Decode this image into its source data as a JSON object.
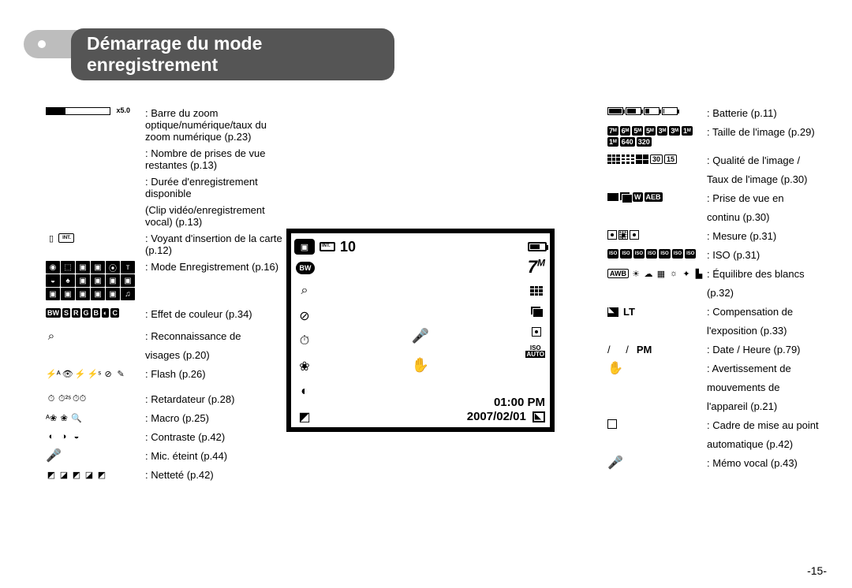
{
  "header": {
    "title": "Démarrage du mode enregistrement"
  },
  "page_number": "-15-",
  "left": {
    "zoom": {
      "scale_label": "x5.0",
      "text": "Barre du zoom optique/numérique/taux du zoom numérique (p.23)"
    },
    "shots": {
      "text": "Nombre de prises de vue restantes (p.13)"
    },
    "duration1": {
      "text": "Durée d'enregistrement disponible"
    },
    "duration2": {
      "text": "(Clip vidéo/enregistrement vocal) (p.13)"
    },
    "card": {
      "text": "Voyant d'insertion de la carte (p.12)"
    },
    "mode": {
      "text": "Mode Enregistrement (p.16)"
    },
    "color": {
      "text": "Effet de couleur (p.34)"
    },
    "face1": {
      "text": "Reconnaissance de"
    },
    "face2": {
      "text": "visages (p.20)"
    },
    "flash": {
      "text": "Flash (p.26)"
    },
    "timer": {
      "text": "Retardateur (p.28)"
    },
    "macro": {
      "text": "Macro (p.25)"
    },
    "contrast": {
      "text": "Contraste (p.42)"
    },
    "mic": {
      "text": "Mic. éteint (p.44)"
    },
    "sharp": {
      "text": "Netteté (p.42)"
    }
  },
  "lcd": {
    "shots_remaining": "10",
    "resolution": "7",
    "resolution_suffix": "M",
    "iso_label": "ISO",
    "iso_mode": "AUTO",
    "time": "01:00 PM",
    "date": "2007/02/01"
  },
  "right": {
    "battery": {
      "text": "Batterie (p.11)"
    },
    "size": {
      "text": "Taille de l'image (p.29)",
      "labels": [
        "7ᴹ",
        "6ᴹ",
        "5ᴹ",
        "5ᴹ",
        "3ᴹ",
        "3ᴹ",
        "1ᴹ",
        "1ᴹ",
        "640",
        "320"
      ]
    },
    "quality1": {
      "text": "Qualité de l'image /",
      "fr": [
        "30",
        "15"
      ]
    },
    "quality2": {
      "text": "Taux de l'image (p.30)"
    },
    "drive1": {
      "text": "Prise de vue en",
      "labels": [
        "",
        "",
        "W",
        "AEB"
      ]
    },
    "drive2": {
      "text": "continu (p.30)"
    },
    "metering": {
      "text": "Mesure (p.31)"
    },
    "iso": {
      "text": "ISO (p.31)"
    },
    "wb1": {
      "text": "Équilibre des blancs",
      "labels": [
        "AWB",
        "☀",
        "☁",
        "▦",
        "☼",
        "✦",
        "▙"
      ]
    },
    "wb2": {
      "text": "(p.32)"
    },
    "ev1": {
      "lt": "LT",
      "text": "Compensation de"
    },
    "ev2": {
      "text": "l'exposition (p.33)"
    },
    "date": {
      "slashes": "/   /",
      "pm": "PM",
      "text": "Date / Heure (p.79)"
    },
    "shake1": {
      "text": "Avertissement de"
    },
    "shake2": {
      "text": "mouvements de"
    },
    "shake3": {
      "text": "l'appareil (p.21)"
    },
    "afframe1": {
      "text": "Cadre de mise au point"
    },
    "afframe2": {
      "text": "automatique (p.42)"
    },
    "voice": {
      "text": "Mémo vocal (p.43)"
    }
  }
}
